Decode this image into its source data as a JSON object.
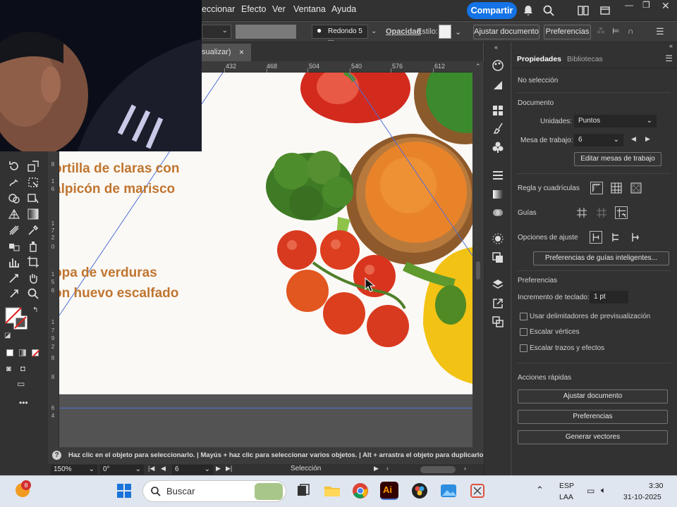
{
  "menubar": {
    "items": [
      "eccionar",
      "Efecto",
      "Ver",
      "Ventana",
      "Ayuda"
    ],
    "share_label": "Compartir"
  },
  "controlbar": {
    "brush_label": "Redondo 5 ...",
    "opacity_label": "Opacidad",
    "style_label": "Estilo:",
    "fit_doc_button": "Ajustar documento",
    "prefs_button": "Preferencias"
  },
  "document": {
    "tab_label": "sualizar)",
    "close_glyph": "×"
  },
  "ruler": {
    "h_ticks": [
      "432",
      "468",
      "504",
      "540",
      "576",
      "612"
    ],
    "v_digits": [
      "8",
      "1",
      "6",
      "1",
      "7",
      "2",
      "0",
      "1",
      "5",
      "6",
      "1",
      "7",
      "9",
      "2",
      "8",
      "8",
      "6",
      "4"
    ]
  },
  "artboard": {
    "recipes": [
      {
        "line1": "ortilla de claras con",
        "line2": "alpicón de marisco"
      },
      {
        "line1": "opa de verduras",
        "line2": "on huevo escalfado"
      }
    ]
  },
  "panel": {
    "tabs": [
      "Propiedades",
      "Bibliotecas"
    ],
    "no_selection": "No selección",
    "document_section": "Documento",
    "units_label": "Unidades:",
    "units_value": "Puntos",
    "artboard_label": "Mesa de trabajo:",
    "artboard_value": "6",
    "edit_artboards_button": "Editar mesas de trabajo",
    "rulers_grids_label": "Regla y cuadrículas",
    "guides_label": "Guías",
    "snap_options_label": "Opciones de ajuste",
    "smart_guides_button": "Preferencias de guías inteligentes...",
    "preferences_section": "Preferencias",
    "keyboard_increment_label": "Incremento de teclado:",
    "keyboard_increment_value": "1 pt",
    "checkboxes": [
      "Usar delimitadores de previsualización",
      "Escalar vértices",
      "Escalar trazos y efectos"
    ],
    "quick_actions_section": "Acciones rápidas",
    "quick_actions": [
      "Ajustar documento",
      "Preferencias",
      "Generar vectores"
    ]
  },
  "statusbar": {
    "hint": "Haz clic en el objeto para seleccionarlo.  |  Mayús + haz clic para seleccionar varios objetos.  |  Alt + arrastra el objeto para duplicarlo"
  },
  "bottombar": {
    "zoom": "150%",
    "rotation": "0°",
    "artboard_number": "6",
    "tool_name": "Selección"
  },
  "taskbar": {
    "search_placeholder": "Buscar",
    "notification_count": "8",
    "language": "ESP",
    "layout": "LAA",
    "time": "3:30",
    "date": "31-10-2025"
  },
  "colors": {
    "accent": "#1473e6",
    "panel_bg": "#323232",
    "canvas_bg": "#535353",
    "recipe_text": "#c0752f"
  }
}
